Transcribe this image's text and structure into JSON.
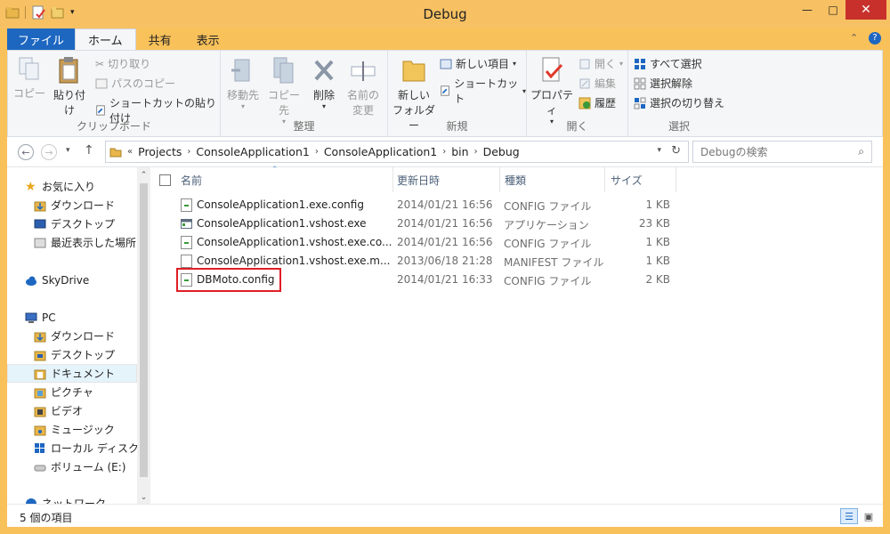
{
  "window": {
    "title": "Debug",
    "controls": {
      "minimize": "—",
      "maximize": "□",
      "close": "✕"
    }
  },
  "ribbon_tabs": [
    "ファイル",
    "ホーム",
    "共有",
    "表示"
  ],
  "ribbon_controls": {
    "collapse": "⌃",
    "help": "?"
  },
  "ribbon": {
    "clipboard": {
      "label": "クリップボード",
      "copy": "コピー",
      "paste": "貼り付け",
      "cut": "切り取り",
      "copy_path": "パスのコピー",
      "paste_shortcut": "ショートカットの貼り付け"
    },
    "organize": {
      "label": "整理",
      "move_to": "移動先",
      "copy_to": "コピー先",
      "delete": "削除",
      "rename_1": "名前の",
      "rename_2": "変更"
    },
    "new": {
      "label": "新規",
      "new_folder_1": "新しい",
      "new_folder_2": "フォルダー",
      "new_item": "新しい項目",
      "shortcut": "ショートカット"
    },
    "open": {
      "label": "開く",
      "properties": "プロパティ",
      "open": "開く",
      "edit": "編集",
      "history": "履歴"
    },
    "select": {
      "label": "選択",
      "select_all": "すべて選択",
      "select_none": "選択解除",
      "invert": "選択の切り替え"
    }
  },
  "address": {
    "overflow": "«",
    "crumbs": [
      "Projects",
      "ConsoleApplication1",
      "ConsoleApplication1",
      "bin",
      "Debug"
    ],
    "search_placeholder": "Debugの検索"
  },
  "nav": {
    "favorites": "お気に入り",
    "fav_items": [
      "ダウンロード",
      "デスクトップ",
      "最近表示した場所"
    ],
    "skydrive": "SkyDrive",
    "pc": "PC",
    "pc_items": [
      "ダウンロード",
      "デスクトップ",
      "ドキュメント",
      "ピクチャ",
      "ビデオ",
      "ミュージック",
      "ローカル ディスク (C",
      "ボリューム (E:)"
    ],
    "network": "ネットワーク"
  },
  "columns": {
    "name": "名前",
    "date": "更新日時",
    "type": "種類",
    "size": "サイズ"
  },
  "files": [
    {
      "name": "ConsoleApplication1.exe.config",
      "date": "2014/01/21 16:56",
      "type": "CONFIG ファイル",
      "size": "1 KB",
      "icon": "config-file-icon"
    },
    {
      "name": "ConsoleApplication1.vshost.exe",
      "date": "2014/01/21 16:56",
      "type": "アプリケーション",
      "size": "23 KB",
      "icon": "exe-file-icon"
    },
    {
      "name": "ConsoleApplication1.vshost.exe.co...",
      "date": "2014/01/21 16:56",
      "type": "CONFIG ファイル",
      "size": "1 KB",
      "icon": "config-file-icon"
    },
    {
      "name": "ConsoleApplication1.vshost.exe.m...",
      "date": "2013/06/18 21:28",
      "type": "MANIFEST ファイル",
      "size": "1 KB",
      "icon": "manifest-file-icon"
    },
    {
      "name": "DBMoto.config",
      "date": "2014/01/21 16:33",
      "type": "CONFIG ファイル",
      "size": "2 KB",
      "icon": "config-file-icon"
    }
  ],
  "status": {
    "item_count": "5 個の項目"
  },
  "colors": {
    "accent": "#1d67c1",
    "frame": "#f8c15a",
    "highlight": "#e01d25",
    "close": "#c7302b"
  }
}
